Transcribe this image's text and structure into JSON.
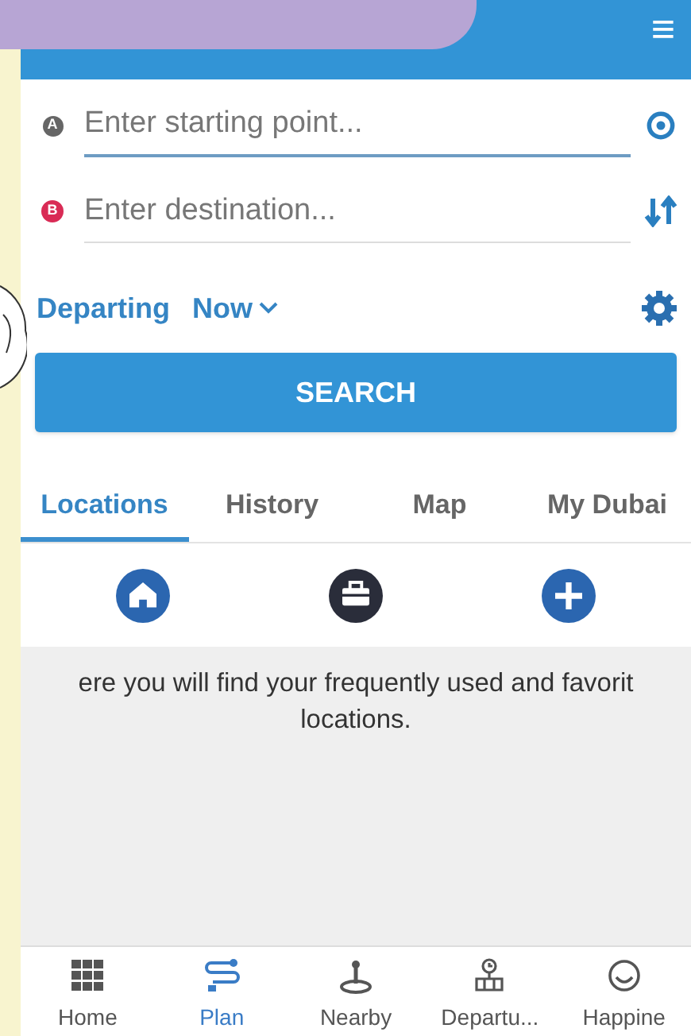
{
  "header": {
    "menu": "≡"
  },
  "route": {
    "start": {
      "marker": "A",
      "placeholder": "Enter starting point..."
    },
    "destination": {
      "marker": "B",
      "placeholder": "Enter destination..."
    }
  },
  "departing": {
    "label": "Departing",
    "value": "Now"
  },
  "search_button": "SEARCH",
  "tabs": [
    {
      "label": "Locations",
      "selected": true
    },
    {
      "label": "History",
      "selected": false
    },
    {
      "label": "Map",
      "selected": false
    },
    {
      "label": "My Dubai",
      "selected": false
    }
  ],
  "shortcuts": [
    {
      "kind": "home"
    },
    {
      "kind": "work"
    },
    {
      "kind": "add"
    }
  ],
  "empty_message": "ere you will find your frequently used and favorit locations.",
  "bottom_nav": [
    {
      "label": "Home",
      "kind": "grid",
      "selected": false
    },
    {
      "label": "Plan",
      "kind": "route",
      "selected": true
    },
    {
      "label": "Nearby",
      "kind": "pin",
      "selected": false
    },
    {
      "label": "Departu...",
      "kind": "clock",
      "selected": false
    },
    {
      "label": "Happine",
      "kind": "smile",
      "selected": false
    }
  ]
}
